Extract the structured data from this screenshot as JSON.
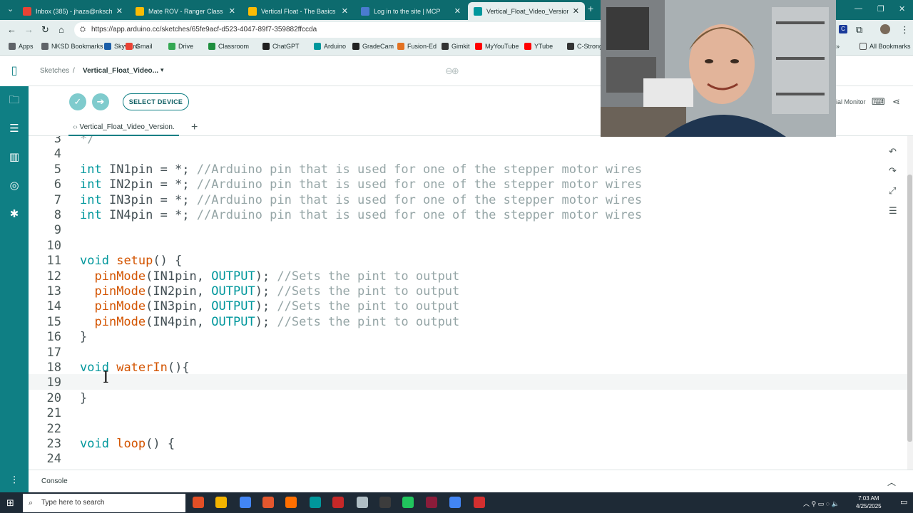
{
  "browser": {
    "tabs": [
      {
        "title": "Inbox (385) - jhaza@nkschools...",
        "color": "#ea4335"
      },
      {
        "title": "Mate ROV - Ranger Class - Go...",
        "color": "#fbbc04"
      },
      {
        "title": "Vertical Float - The Basics - Go...",
        "color": "#fbbc04"
      },
      {
        "title": "Log in to the site | MCP",
        "color": "#4a7bd0"
      },
      {
        "title": "Vertical_Float_Video_Version_...",
        "color": "#00979c"
      }
    ],
    "url": "https://app.arduino.cc/sketches/65fe9acf-d523-4047-89f7-359882ffccda",
    "bookmarks": [
      {
        "label": "Apps",
        "color": "#5f6368"
      },
      {
        "label": "NKSD Bookmarks",
        "color": "#5f6368"
      },
      {
        "label": "Skyward",
        "color": "#1a5ea8"
      },
      {
        "label": "Gmail",
        "color": "#ea4335"
      },
      {
        "label": "Drive",
        "color": "#34a853"
      },
      {
        "label": "Classroom",
        "color": "#1e8e3e"
      },
      {
        "label": "ChatGPT",
        "color": "#202020"
      },
      {
        "label": "Arduino",
        "color": "#00979c"
      },
      {
        "label": "GradeCam",
        "color": "#222"
      },
      {
        "label": "Fusion-Ed",
        "color": "#e37222"
      },
      {
        "label": "Gimkit",
        "color": "#333"
      },
      {
        "label": "MyYouTube",
        "color": "#ff0000"
      },
      {
        "label": "YTube",
        "color": "#ff0000"
      },
      {
        "label": "C-Strong",
        "color": "#333"
      }
    ],
    "all_bookmarks": "All Bookmarks"
  },
  "app": {
    "breadcrumb_sketches": "Sketches",
    "sketch_name": "Vertical_Float_Video...",
    "select_device": "SELECT DEVICE",
    "serial_monitor": "erial Monitor",
    "file_tab": "Vertical_Float_Video_Version.",
    "console_label": "Console"
  },
  "editor": {
    "lines": [
      {
        "n": "3",
        "html": "<span class=\"cm\">*/</span>"
      },
      {
        "n": "4",
        "html": ""
      },
      {
        "n": "5",
        "html": "<span class=\"kw\">int</span> IN1pin = *; <span class=\"cm\">//Arduino pin that is used for one of the stepper motor wires</span>"
      },
      {
        "n": "6",
        "html": "<span class=\"kw\">int</span> IN2pin = *; <span class=\"cm\">//Arduino pin that is used for one of the stepper motor wires</span>"
      },
      {
        "n": "7",
        "html": "<span class=\"kw\">int</span> IN3pin = *; <span class=\"cm\">//Arduino pin that is used for one of the stepper motor wires</span>"
      },
      {
        "n": "8",
        "html": "<span class=\"kw\">int</span> IN4pin = *; <span class=\"cm\">//Arduino pin that is used for one of the stepper motor wires</span>"
      },
      {
        "n": "9",
        "html": ""
      },
      {
        "n": "10",
        "html": ""
      },
      {
        "n": "11",
        "html": "<span class=\"kw\">void</span> <span class=\"fn\">setup</span>() {"
      },
      {
        "n": "12",
        "html": "  <span class=\"fn\">pinMode</span>(IN1pin, <span class=\"cst\">OUTPUT</span>); <span class=\"cm\">//Sets the pint to output</span>"
      },
      {
        "n": "13",
        "html": "  <span class=\"fn\">pinMode</span>(IN2pin, <span class=\"cst\">OUTPUT</span>); <span class=\"cm\">//Sets the pint to output</span>"
      },
      {
        "n": "14",
        "html": "  <span class=\"fn\">pinMode</span>(IN3pin, <span class=\"cst\">OUTPUT</span>); <span class=\"cm\">//Sets the pint to output</span>"
      },
      {
        "n": "15",
        "html": "  <span class=\"fn\">pinMode</span>(IN4pin, <span class=\"cst\">OUTPUT</span>); <span class=\"cm\">//Sets the pint to output</span>"
      },
      {
        "n": "16",
        "html": "}"
      },
      {
        "n": "17",
        "html": ""
      },
      {
        "n": "18",
        "html": "<span class=\"kw\">void</span> <span class=\"fn\">waterIn</span>(){"
      },
      {
        "n": "19",
        "html": ""
      },
      {
        "n": "20",
        "html": "}"
      },
      {
        "n": "21",
        "html": ""
      },
      {
        "n": "22",
        "html": ""
      },
      {
        "n": "23",
        "html": "<span class=\"kw\">void</span> <span class=\"fn\">loop</span>() {"
      },
      {
        "n": "24",
        "html": ""
      }
    ]
  },
  "taskbar": {
    "search_placeholder": "Type here to search",
    "time": "7:03 AM",
    "date": "4/25/2025",
    "apps": [
      "#e34f26",
      "#f4b400",
      "#4285f4",
      "#e4572e",
      "#ff6f00",
      "#00979c",
      "#c62828",
      "#b0bec5",
      "#3c3c3c",
      "#21c55d",
      "#8b1c3a",
      "#4285f4",
      "#d32f2f"
    ]
  }
}
